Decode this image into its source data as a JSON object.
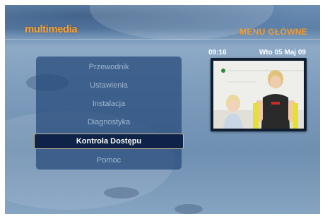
{
  "header": {
    "logo_text": "multimedia",
    "screen_title": "MENU GŁÓWNE"
  },
  "status": {
    "time": "09:16",
    "date": "Wto 05 Maj 09"
  },
  "menu": {
    "items": [
      {
        "label": "Przewodnik"
      },
      {
        "label": "Ustawienia"
      },
      {
        "label": "Instalacja"
      },
      {
        "label": "Diagnostyka"
      },
      {
        "label": "Kontrola Dostępu"
      },
      {
        "label": "Pomoc"
      }
    ],
    "selected_index": 4
  },
  "colors": {
    "accent": "#f29a2e",
    "selected_bg": "#0e2347",
    "panel_bg": "#244878"
  }
}
